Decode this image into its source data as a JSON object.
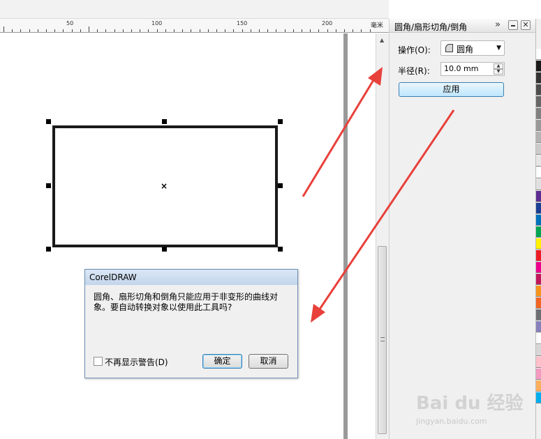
{
  "ruler": {
    "labels": [
      "50",
      "100",
      "150",
      "200"
    ],
    "unit": "毫米"
  },
  "docker": {
    "title": "圆角/扇形切角/倒角",
    "expand_icon": "double-chevron-right",
    "minimize_icon": "minimize",
    "close_icon": "close",
    "operation_label": "操作(O):",
    "operation_value": "圆角",
    "radius_label": "半径(R):",
    "radius_value": "10.0 mm",
    "apply_label": "应用"
  },
  "dialog": {
    "title": "CorelDRAW",
    "message": "圆角、扇形切角和倒角只能应用于非变形的曲线对象。要自动转换对象以使用此工具吗?",
    "checkbox_label": "不再显示警告(D)",
    "checkbox_checked": false,
    "ok_label": "确定",
    "cancel_label": "取消"
  },
  "palette": {
    "colors": [
      "#ffffff",
      "#1a1a1a",
      "#333333",
      "#4d4d4d",
      "#666666",
      "#808080",
      "#999999",
      "#b3b3b3",
      "#cccccc",
      "#e6e6e6",
      "#ffffff",
      "#e0e0e0",
      "#5c2d91",
      "#1b3f94",
      "#0072bc",
      "#00a651",
      "#fff200",
      "#ed1c24",
      "#ec008c",
      "#c2185b",
      "#f7941d",
      "#f26522",
      "#6d6e71",
      "#8781bd",
      "#ffffff",
      "#d7d7d7",
      "#ffc0cb",
      "#f49ac1",
      "#fbaf5d",
      "#00aeef"
    ]
  },
  "watermark": {
    "text": "Bai du 经验",
    "url": "jingyan.baidu.com"
  }
}
